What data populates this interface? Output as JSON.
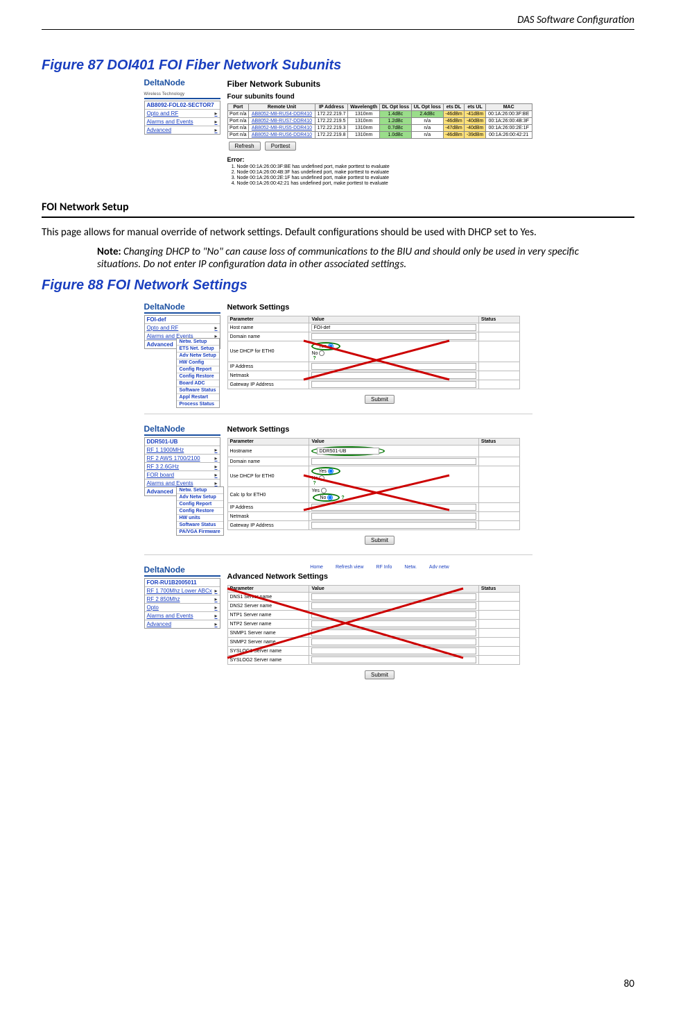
{
  "header": {
    "title": "DAS Software Configuration"
  },
  "page_number": "80",
  "figure87": {
    "title": "Figure 87    DOI401 FOI Fiber Network Subunits",
    "logo": "DeltaNode",
    "logo_sub": "Wireless  Technology",
    "side_title": "AB8092-FOL02-SECTOR7",
    "side_items": [
      "Opto and RF",
      "Alarms and Events",
      "Advanced"
    ],
    "main_title": "Fiber Network Subunits",
    "subunits_found": "Four subunits found",
    "cols": [
      "Port",
      "Remote Unit",
      "IP Address",
      "Wavelength",
      "DL Opt loss",
      "UL Opt loss",
      "ets DL",
      "ets UL",
      "MAC"
    ],
    "rows": [
      {
        "port": "Port n/a",
        "ru": "AB8052-M8-RUS4-DDR410",
        "ip": "172.22.219.7",
        "wl": "1310nm",
        "dl": "1.4dBc",
        "ul": "2.4dBc",
        "etsdl": "-46dBm",
        "etsul": "-41dBm",
        "mac": "00:1A:26:00:3F:BE"
      },
      {
        "port": "Port n/a",
        "ru": "AB8052-M8-RUS7-DDR410",
        "ip": "172.22.219.5",
        "wl": "1310nm",
        "dl": "1.2dBc",
        "ul": "n/a",
        "etsdl": "-46dBm",
        "etsul": "-40dBm",
        "mac": "00:1A:26:00:4B:3F"
      },
      {
        "port": "Port n/a",
        "ru": "AB8052-M8-RUS5-DDR410",
        "ip": "172.22.219.3",
        "wl": "1310nm",
        "dl": "0.7dBc",
        "ul": "n/a",
        "etsdl": "-47dBm",
        "etsul": "-40dBm",
        "mac": "00:1A:26:00:2E:1F"
      },
      {
        "port": "Port n/a",
        "ru": "AB8052-M8-RUS6-DDR410",
        "ip": "172.22.219.8",
        "wl": "1310nm",
        "dl": "1.0dBc",
        "ul": "n/a",
        "etsdl": "-46dBm",
        "etsul": "-39dBm",
        "mac": "00:1A:26:00:42:21"
      }
    ],
    "btn_refresh": "Refresh",
    "btn_porttest": "Porttest",
    "error_label": "Error:",
    "errors": [
      "Node 00:1A:26:00:3F:BE has undefined port, make porttest to evaluate",
      "Node 00:1A:26:00:4B:3F has undefined port, make porttest to evaluate",
      "Node 00:1A:26:00:2E:1F has undefined port, make porttest to evaluate",
      "Node 00:1A:26:00:42:21 has undefined port, make porttest to evaluate"
    ]
  },
  "section": {
    "title": "FOI Network Setup",
    "body": "This page allows for manual override of network settings. Default configurations should be used with DHCP set to Yes.",
    "note_label": "Note:  ",
    "note_text": "Changing DHCP to \"No\" can cause loss of communications to the BIU and should only be used in very specific situations.   Do not enter IP configuration data in other associated settings."
  },
  "figure88": {
    "title": "Figure 88    FOI Network Settings",
    "panel1": {
      "logo": "DeltaNode",
      "side_title": "FOI-def",
      "side_items": [
        "Opto and RF",
        "Alarms and Events",
        "Advanced"
      ],
      "submenu": [
        "Netw. Setup",
        "ETS Net. Setup",
        "Adv Netw Setup",
        "HW Config",
        "Config Report",
        "Config Restore",
        "Board ADC",
        "Software Status",
        "Appl Restart",
        "Process Status"
      ],
      "title": "Network Settings",
      "th_param": "Parameter",
      "th_val": "Value",
      "th_status": "Status",
      "rows": [
        {
          "p": "Host name",
          "v": "FOI-def"
        },
        {
          "p": "Domain name",
          "v": ""
        },
        {
          "p": "Use DHCP for ETH0",
          "v": "Yes",
          "radio": true
        },
        {
          "p": "IP Address",
          "v": ""
        },
        {
          "p": "Netmask",
          "v": ""
        },
        {
          "p": "Gateway IP Address",
          "v": ""
        }
      ],
      "submit": "Submit",
      "yes": "Yes",
      "no": "No"
    },
    "panel2": {
      "logo": "DeltaNode",
      "side_title": "DDR501-UB",
      "side_items": [
        "RF 1 1900MHz",
        "RF 2 AWS 1700/2100",
        "RF 3 2.6GHz",
        "FOR board",
        "Alarms and Events",
        "Advanced"
      ],
      "submenu": [
        "Netw. Setup",
        "Adv Netw Setup",
        "Config Report",
        "Config Restore",
        "HW units",
        "Software Status",
        "PA/VGA Firmware"
      ],
      "title": "Network Settings",
      "th_param": "Parameter",
      "th_val": "Value",
      "th_status": "Status",
      "rows": [
        {
          "p": "Hostname",
          "v": "DDR501-UB"
        },
        {
          "p": "Domain name",
          "v": ""
        },
        {
          "p": "Use DHCP for ETH0",
          "v": "Yes",
          "radio": true
        },
        {
          "p": "Calc Ip for ETH0",
          "v": "Yes",
          "radio": true,
          "circled": true
        },
        {
          "p": "IP Address",
          "v": ""
        },
        {
          "p": "Netmask",
          "v": ""
        },
        {
          "p": "Gateway IP Address",
          "v": ""
        }
      ],
      "submit": "Submit",
      "yes": "Yes",
      "no": "No"
    },
    "panel3": {
      "logo": "DeltaNode",
      "side_title": "FOR-RU1B2005011",
      "side_items": [
        "RF 1 700Mhz Lower ABCx",
        "RF 2 850Mhz",
        "Opto",
        "Alarms and Events",
        "Advanced"
      ],
      "nav": [
        "Home",
        "Refresh view",
        "RF Info",
        "Netw.",
        "Adv netw"
      ],
      "title": "Advanced Network Settings",
      "th_param": "Parameter",
      "th_val": "Value",
      "th_status": "Status",
      "rows": [
        {
          "p": "DNS1 Server name",
          "v": ""
        },
        {
          "p": "DNS2 Server name",
          "v": ""
        },
        {
          "p": "NTP1 Server name",
          "v": ""
        },
        {
          "p": "NTP2 Server name",
          "v": ""
        },
        {
          "p": "SNMP1 Server name",
          "v": ""
        },
        {
          "p": "SNMP2 Server name",
          "v": ""
        },
        {
          "p": "SYSLOG1 Server name",
          "v": ""
        },
        {
          "p": "SYSLOG2 Server name",
          "v": ""
        }
      ],
      "submit": "Submit"
    }
  }
}
